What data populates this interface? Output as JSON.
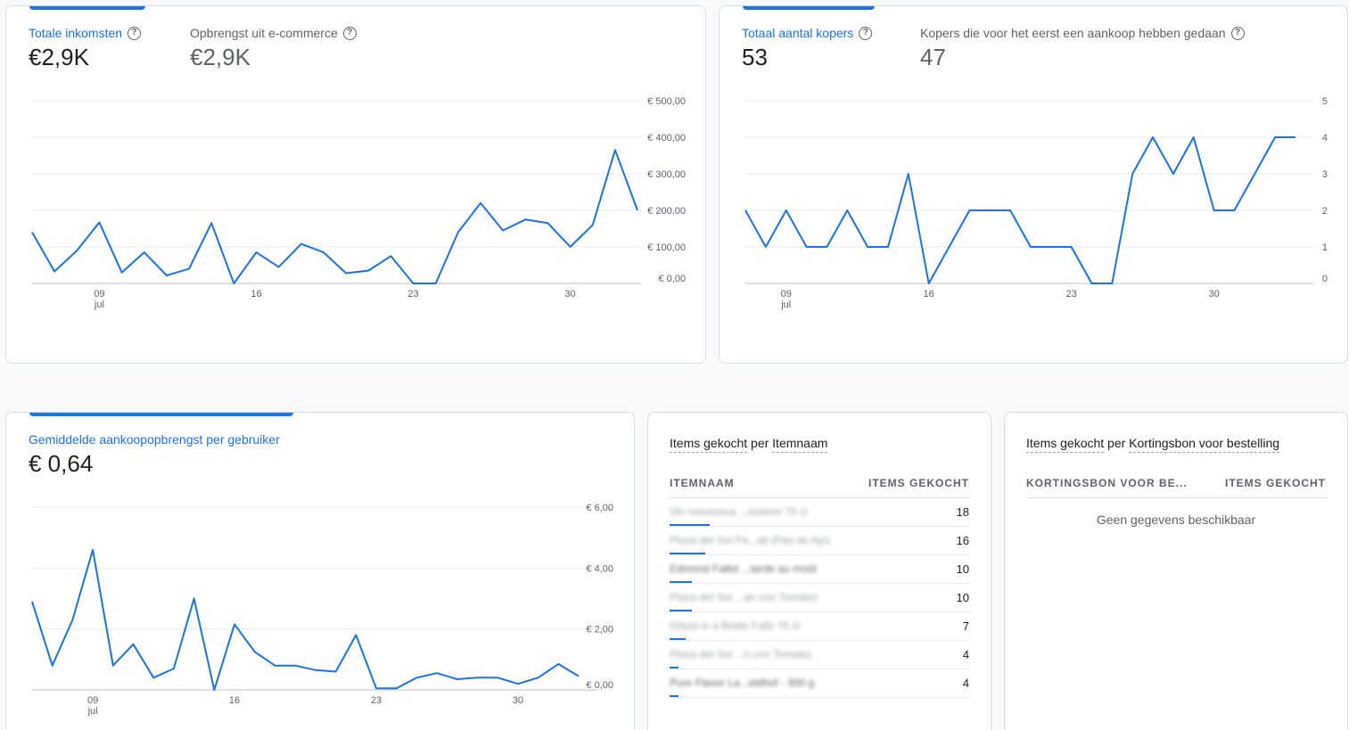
{
  "card1": {
    "metrics": [
      {
        "label": "Totale inkomsten",
        "value": "€2,9K"
      },
      {
        "label": "Opbrengst uit e-commerce",
        "value": "€2,9K"
      }
    ]
  },
  "card2": {
    "metrics": [
      {
        "label": "Totaal aantal kopers",
        "value": "53"
      },
      {
        "label": "Kopers die voor het eerst een aankoop hebben gedaan",
        "value": "47"
      }
    ]
  },
  "card3": {
    "metrics": [
      {
        "label": "Gemiddelde aankoopopbrengst per gebruiker",
        "value": "€ 0,64"
      }
    ]
  },
  "table1": {
    "title_a": "Items gekocht",
    "title_mid": " per ",
    "title_b": "Itemnaam",
    "col_left": "ITEMNAAM",
    "col_right": "ITEMS GEKOCHT",
    "rows": [
      {
        "name": "Vin mousseux ...exterre 75 cl",
        "value": "18",
        "share": 0.135
      },
      {
        "name": "Plaza del Sol Pa...ati (Pan de Ajo)",
        "value": "16",
        "share": 0.12
      },
      {
        "name": "Edmond Fallot ...tarde au moût",
        "value": "10",
        "share": 0.075
      },
      {
        "name": "Plaza del Sol ...an con Tomate)",
        "value": "10",
        "share": 0.075
      },
      {
        "name": "Ghost in a Bottle Fallz 75 cl",
        "value": "7",
        "share": 0.055
      },
      {
        "name": "Plaza del Sol ...n con Tomate)",
        "value": "4",
        "share": 0.03
      },
      {
        "name": "Pure Flavor La...eldhof - 300 g",
        "value": "4",
        "share": 0.03
      }
    ]
  },
  "table2": {
    "title_a": "Items gekocht",
    "title_mid": " per ",
    "title_b": "Kortingsbon voor bestelling",
    "col_left": "KORTINGSBON VOOR BE...",
    "col_right": "ITEMS GEKOCHT",
    "empty": "Geen gegevens beschikbaar"
  },
  "colors": {
    "accent": "#1a73e8",
    "grid": "#e8eaed",
    "text_muted": "#5f6368"
  },
  "icons": {
    "help": "help-circle-icon"
  },
  "chart_data": [
    {
      "type": "line",
      "x_ticks": [
        "09",
        "16",
        "23",
        "30"
      ],
      "x_tick_sub": "jul",
      "x_dates": [
        "2024-07-06",
        "2024-07-07",
        "2024-07-08",
        "2024-07-09",
        "2024-07-10",
        "2024-07-11",
        "2024-07-12",
        "2024-07-13",
        "2024-07-14",
        "2024-07-15",
        "2024-07-16",
        "2024-07-17",
        "2024-07-18",
        "2024-07-19",
        "2024-07-20",
        "2024-07-21",
        "2024-07-22",
        "2024-07-23",
        "2024-07-24",
        "2024-07-25",
        "2024-07-26",
        "2024-07-27",
        "2024-07-28",
        "2024-07-29",
        "2024-07-30",
        "2024-07-31",
        "2024-08-01",
        "2024-08-02",
        "2024-08-03"
      ],
      "tick_index": [
        3,
        10,
        17,
        24
      ],
      "y_ticks": [
        "€ 0,00",
        "€ 100,00",
        "€ 200,00",
        "€ 300,00",
        "€ 400,00",
        "€ 500,00"
      ],
      "ylim": [
        0,
        500
      ],
      "series": [
        {
          "values": [
            140,
            33,
            90,
            167,
            30,
            85,
            22,
            40,
            165,
            0,
            85,
            45,
            108,
            85,
            28,
            35,
            75,
            0,
            0,
            140,
            220,
            145,
            175,
            165,
            100,
            160,
            365,
            200
          ]
        }
      ]
    },
    {
      "type": "line",
      "x_ticks": [
        "09",
        "16",
        "23",
        "30"
      ],
      "x_tick_sub": "jul",
      "tick_index": [
        2,
        9,
        16,
        23
      ],
      "y_ticks": [
        "0",
        "1",
        "2",
        "3",
        "4",
        "5"
      ],
      "ylim": [
        0,
        5
      ],
      "series": [
        {
          "values": [
            2,
            1,
            2,
            1,
            1,
            2,
            1,
            1,
            3,
            0,
            1,
            2,
            2,
            2,
            1,
            1,
            1,
            0,
            0,
            3,
            4,
            3,
            4,
            2,
            2,
            3,
            4,
            4
          ]
        }
      ]
    },
    {
      "type": "line",
      "x_ticks": [
        "09",
        "16",
        "23",
        "30"
      ],
      "x_tick_sub": "jul",
      "tick_index": [
        3,
        10,
        17,
        24
      ],
      "y_ticks": [
        "€ 0,00",
        "€ 2,00",
        "€ 4,00",
        "€ 6,00"
      ],
      "ylim": [
        0,
        6
      ],
      "series": [
        {
          "values": [
            2.9,
            0.8,
            2.3,
            4.6,
            0.8,
            1.5,
            0.4,
            0.7,
            3.0,
            0.0,
            2.15,
            1.25,
            0.8,
            0.8,
            0.65,
            0.6,
            1.8,
            0.05,
            0.05,
            0.4,
            0.55,
            0.35,
            0.4,
            0.4,
            0.2,
            0.4,
            0.85,
            0.45
          ]
        }
      ]
    }
  ]
}
